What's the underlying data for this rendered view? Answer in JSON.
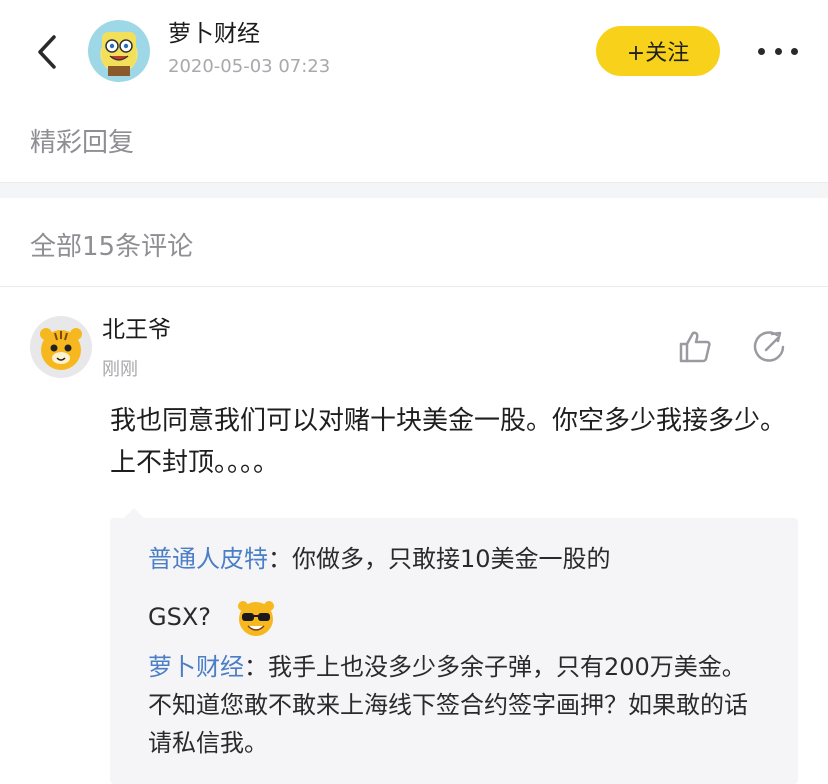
{
  "header": {
    "author_name": "萝卜财经",
    "post_time": "2020-05-03 07:23",
    "follow_label": "+关注",
    "icons": [
      "back-icon",
      "more-icon"
    ]
  },
  "sections": {
    "featured_title": "精彩回复",
    "all_comments_title": "全部15条评论"
  },
  "comment": {
    "user_name": "北王爷",
    "time": "刚刚",
    "text": "我也同意我们可以对赌十块美金一股。你空多少我接多少。上不封顶。。。。",
    "icons": [
      "like-icon",
      "share-icon"
    ]
  },
  "quote": {
    "reply1_user": "普通人皮特",
    "reply1_sep": "：",
    "reply1_text": "你做多，只敢接10美金一股的",
    "reply1_tail": "GSX?",
    "reply2_user": "萝卜财经",
    "reply2_sep": "：",
    "reply2_text": "我手上也没多少多余子弹，只有200万美金。不知道您敢不敢来上海线下签合约签字画押？如果敢的话请私信我。"
  },
  "colors": {
    "follow_bg": "#f8d21a",
    "link_blue": "#4a7ec6",
    "muted_gray": "#8e8e93"
  }
}
